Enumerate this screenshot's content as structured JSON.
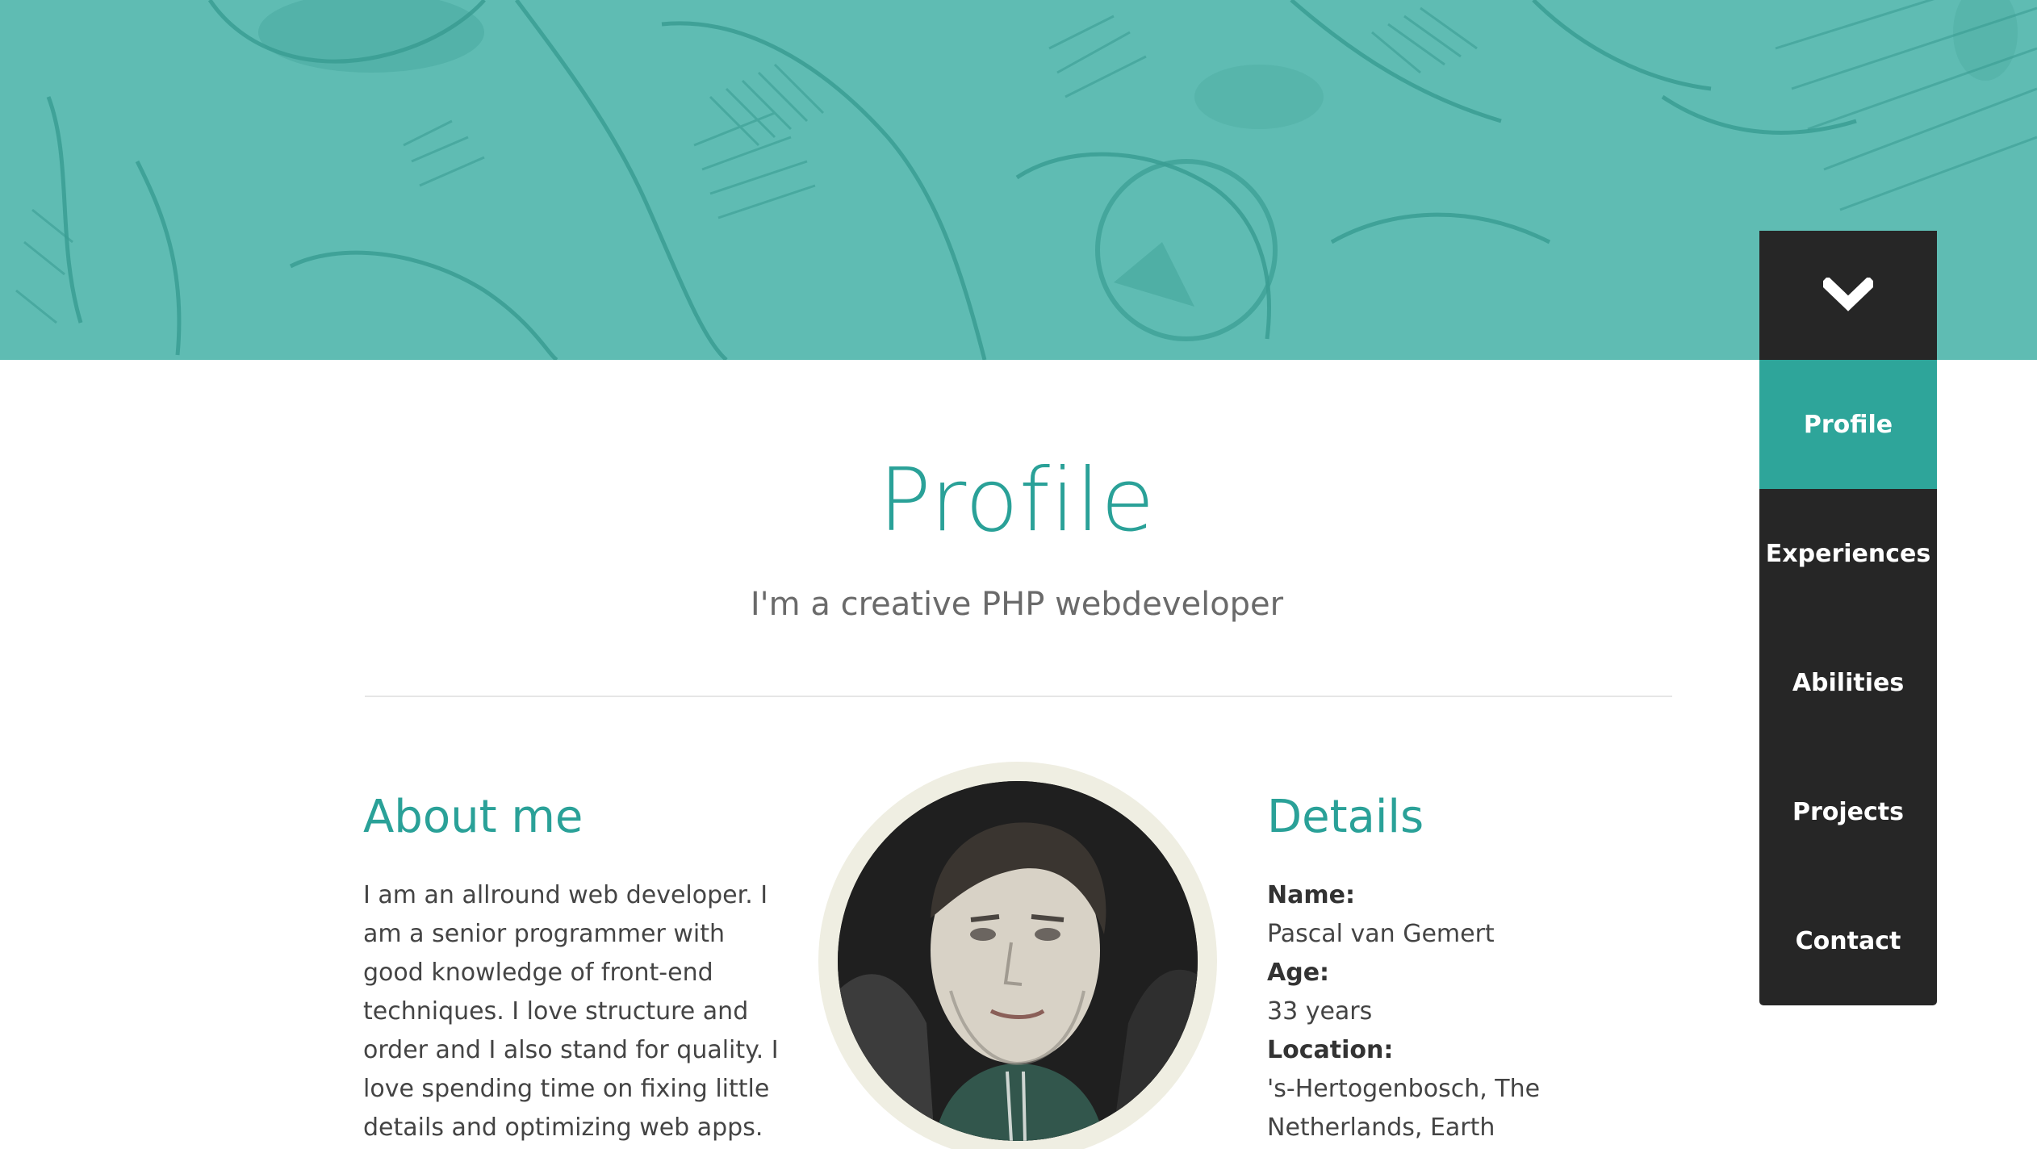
{
  "colors": {
    "accent": "#2aa198",
    "hero": "#5fbcb3",
    "nav_bg": "#262626",
    "nav_active": "#2ea59a"
  },
  "nav": {
    "toggle_icon": "chevron-down-icon",
    "items": [
      {
        "label": "Profile",
        "active": true
      },
      {
        "label": "Experiences",
        "active": false
      },
      {
        "label": "Abilities",
        "active": false
      },
      {
        "label": "Projects",
        "active": false
      },
      {
        "label": "Contact",
        "active": false
      }
    ]
  },
  "profile": {
    "title": "Profile",
    "subtitle": "I'm a creative PHP webdeveloper"
  },
  "about": {
    "heading": "About me",
    "text": "I am an allround web developer. I am a senior programmer with good knowledge of front-end techniques. I love structure and order and I also stand for quality. I love spending time on fixing little details and optimizing web apps. Also I like"
  },
  "details": {
    "heading": "Details",
    "name_label": "Name:",
    "name_value": "Pascal van Gemert",
    "age_label": "Age:",
    "age_value": "33 years",
    "location_label": "Location:",
    "location_value": "'s-Hertogenbosch, The Netherlands, Earth"
  }
}
